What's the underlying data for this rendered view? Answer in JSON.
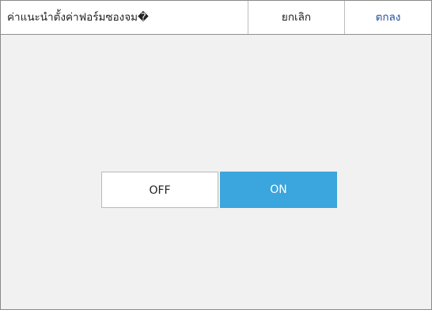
{
  "header": {
    "title": "ค่าแนะนำตั้งค่าฟอร์มซองจม�",
    "cancel_label": "ยกเลิก",
    "ok_label": "ตกลง"
  },
  "toggle": {
    "off_label": "OFF",
    "on_label": "ON",
    "selected": "ON"
  },
  "colors": {
    "accent": "#3aa6dd",
    "ok_text": "#1f4f9c",
    "background": "#f1f1f1"
  }
}
